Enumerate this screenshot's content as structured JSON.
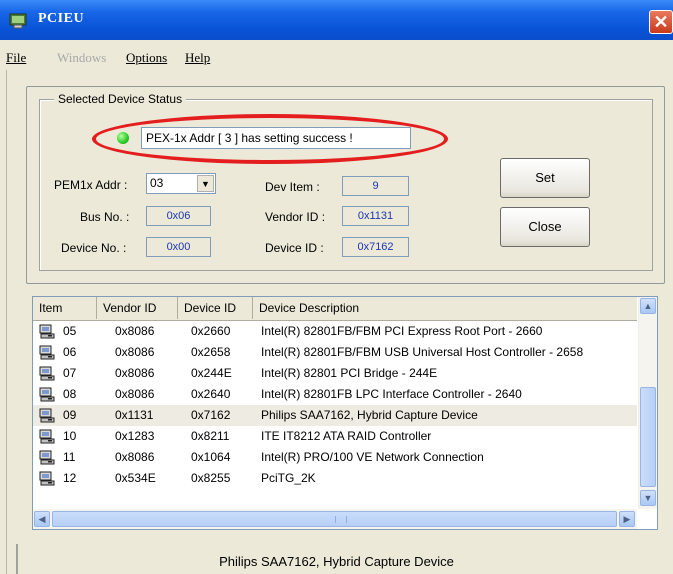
{
  "window": {
    "title": "PCIEU",
    "close_glyph": "✕"
  },
  "menu": {
    "items": [
      {
        "label": "File",
        "enabled": true
      },
      {
        "label": "Windows",
        "enabled": false
      },
      {
        "label": "Options",
        "enabled": true
      },
      {
        "label": "Help",
        "enabled": true
      }
    ]
  },
  "group": {
    "label": "Selected Device Status",
    "status_message": "PEX-1x Addr [ 3 ] has setting success !",
    "led_color": "#30d030",
    "highlight_color": "#e41e1e"
  },
  "fields": {
    "addr_label": "PEM1x Addr :",
    "addr_value": "03",
    "bus_label": "Bus No. :",
    "bus_value": "0x06",
    "device_no_label": "Device No. :",
    "device_no_value": "0x00",
    "dev_item_label": "Dev Item :",
    "dev_item_value": "9",
    "vendor_label": "Vendor ID :",
    "vendor_value": "0x1131",
    "device_id_label": "Device ID :",
    "device_id_value": "0x7162"
  },
  "buttons": {
    "set": "Set",
    "close": "Close"
  },
  "table": {
    "columns": [
      "Item",
      "Vendor ID",
      "Device ID",
      "Device Description"
    ],
    "rows": [
      {
        "item": "05",
        "vendor": "0x8086",
        "device": "0x2660",
        "desc": "Intel(R) 82801FB/FBM PCI Express Root Port - 2660"
      },
      {
        "item": "06",
        "vendor": "0x8086",
        "device": "0x2658",
        "desc": "Intel(R) 82801FB/FBM USB Universal Host Controller - 2658"
      },
      {
        "item": "07",
        "vendor": "0x8086",
        "device": "0x244E",
        "desc": "Intel(R) 82801 PCI Bridge - 244E"
      },
      {
        "item": "08",
        "vendor": "0x8086",
        "device": "0x2640",
        "desc": "Intel(R) 82801FB LPC Interface Controller - 2640"
      },
      {
        "item": "09",
        "vendor": "0x1131",
        "device": "0x7162",
        "desc": "Philips SAA7162, Hybrid Capture Device",
        "selected": true
      },
      {
        "item": "10",
        "vendor": "0x1283",
        "device": "0x8211",
        "desc": "ITE IT8212 ATA RAID Controller"
      },
      {
        "item": "11",
        "vendor": "0x8086",
        "device": "0x1064",
        "desc": "Intel(R) PRO/100 VE Network Connection"
      },
      {
        "item": "12",
        "vendor": "0x534E",
        "device": "0x8255",
        "desc": "PciTG_2K"
      }
    ]
  },
  "statusbar": {
    "text": "Philips SAA7162, Hybrid Capture Device"
  }
}
